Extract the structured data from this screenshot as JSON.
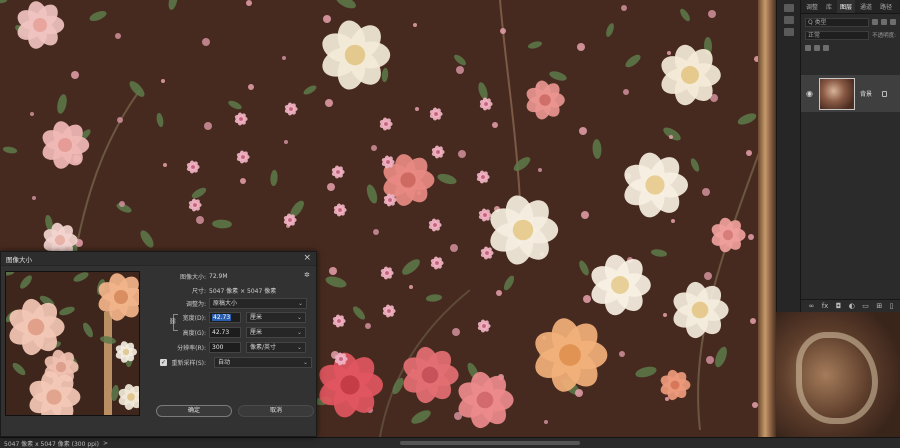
{
  "panels": {
    "tabs": [
      "调整",
      "库",
      "图层",
      "通道",
      "路径"
    ],
    "active_tab_index": 2,
    "search_placeholder": "Q 类型",
    "blend_mode": "正常",
    "opacity_label": "不透明度:",
    "layer": {
      "name": "背景"
    }
  },
  "status": {
    "text": "5047 像素 x 5047 像素 (300 ppi)",
    "chevron": ">"
  },
  "dialog": {
    "title": "图像大小",
    "close": "×",
    "image_size_label": "图像大小:",
    "image_size_value": "72.9M",
    "dimensions_label": "尺寸:",
    "dimensions_value": "5047 像素 × 5047 像素",
    "fit_label": "调整为:",
    "fit_value": "原稿大小",
    "width_label": "宽度(D):",
    "width_value": "42.73",
    "width_unit": "厘米",
    "height_label": "高度(G):",
    "height_value": "42.73",
    "height_unit": "厘米",
    "resolution_label": "分辨率(R):",
    "resolution_value": "300",
    "resolution_unit": "像素/英寸",
    "resample_label": "重新采样(S):",
    "resample_value": "自动",
    "resample_checked": true,
    "ok_label": "确定",
    "cancel_label": "取消"
  }
}
